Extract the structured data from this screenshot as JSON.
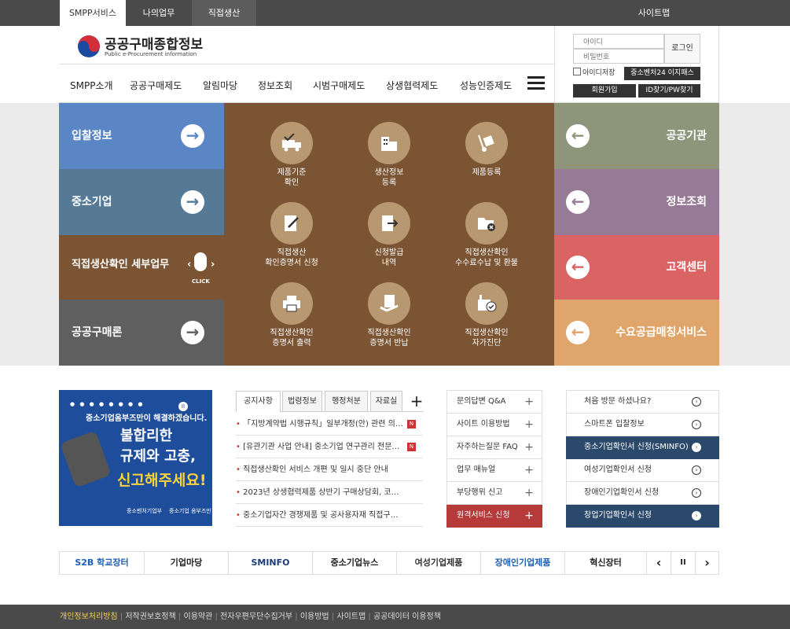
{
  "topbar": {
    "tabs": [
      "SMPP서비스",
      "나의업무",
      "직접생산"
    ],
    "sitemap": "사이트맵"
  },
  "logo": {
    "title": "공공구매종합정보",
    "subtitle": "Public e-Procurement information"
  },
  "menu": [
    "SMPP소개",
    "공공구매제도",
    "알림마당",
    "정보조회",
    "시범구매제도",
    "상생협력제도",
    "성능인증제도"
  ],
  "login": {
    "id_ph": "아이디",
    "pw_ph": "비밀번호",
    "login": "로그인",
    "save_id": "아이디저장",
    "easy": "중소벤처24 이지패스",
    "join": "회원가입",
    "find": "ID찾기/PW찾기"
  },
  "left_blocks": [
    "입찰정보",
    "중소기업",
    "직접생산확인 세부업무",
    "공공구매론"
  ],
  "click": "CLICK",
  "right_blocks": [
    "공공기관",
    "정보조회",
    "고객센터",
    "수요공급매칭서비스"
  ],
  "services": [
    {
      "l1": "제품기준",
      "l2": "확인"
    },
    {
      "l1": "생산정보",
      "l2": "등록"
    },
    {
      "l1": "제품등록",
      "l2": ""
    },
    {
      "l1": "직접생산",
      "l2": "확인증명서 신청"
    },
    {
      "l1": "신청발급",
      "l2": "내역"
    },
    {
      "l1": "직접생산확인",
      "l2": "수수료수납 및 환불"
    },
    {
      "l1": "직접생산확인",
      "l2": "증명서 출력"
    },
    {
      "l1": "직접생산확인",
      "l2": "증명서 반납"
    },
    {
      "l1": "직접생산확인",
      "l2": "자가진단"
    }
  ],
  "promo": {
    "line1": "중소기업옴부즈만이 해결하겠습니다.",
    "line2": "불합리한",
    "line3": "규제와 고충,",
    "line4": "신고해주세요!",
    "org1": "중소벤처기업부",
    "org2": "중소기업 옴부즈만"
  },
  "notice_tabs": [
    "공지사항",
    "법령정보",
    "행정처분",
    "자료실"
  ],
  "plus": "+",
  "notices": [
    "「지방계약법 시행규칙」일부개정(안) 관련 의…",
    "[유관기관 사업 안내] 중소기업 연구관리 전문…",
    "직접생산확인 서비스 개편 및 일시 중단 안내",
    "2023년 상생협력제품 상반기 구매상담회, 코…",
    "중소기업자간 경쟁제품 및 공사용자재 직접구…"
  ],
  "new_badge": "N",
  "mid_links": [
    "문의답변 Q&A",
    "사이트 이용방법",
    "자주하는질문 FAQ",
    "업무 매뉴얼",
    "부당행위 신고",
    "원격서비스 신청"
  ],
  "right_links": [
    "처음 방문 하셨나요?",
    "스마트폰 입찰정보",
    "중소기업확인서 신청(SMINFO)",
    "여성기업확인서 신청",
    "장애인기업확인서 신청",
    "창업기업확인서 신청"
  ],
  "banners": [
    "S2B 학교장터",
    "기업마당",
    "SMINFO",
    "중소기업뉴스",
    "여성기업제품",
    "장애인기업제품",
    "혁신장터"
  ],
  "banner_ctrl": [
    "‹",
    "II",
    "›"
  ],
  "footer": [
    "개인정보처리방침",
    "저작권보호정책",
    "이용약관",
    "전자우편무단수집거부",
    "이용방법",
    "사이트맵",
    "공공데이터 이용정책"
  ],
  "colors": {
    "blue": "#5b86c5",
    "steel": "#567a96",
    "brown": "#7b5434",
    "gray": "#5f5f5f",
    "olive": "#8e957b",
    "mauve": "#967a96",
    "red": "#da6464",
    "orange": "#e0a56a",
    "navy": "#2b4a6b",
    "maroon": "#b73a3a"
  }
}
